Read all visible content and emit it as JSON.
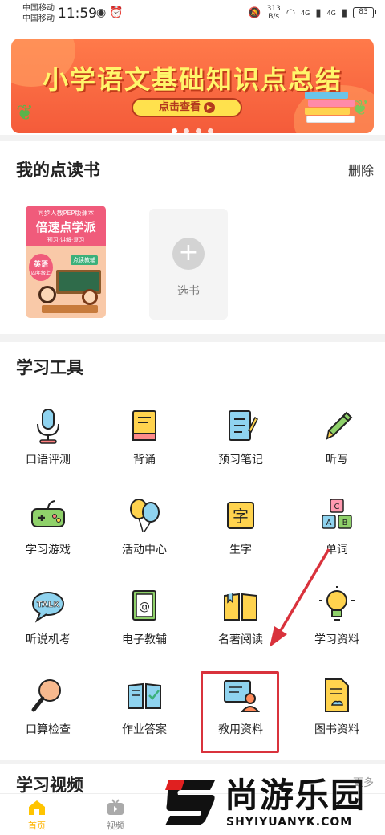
{
  "status": {
    "carrier1": "中国移动",
    "carrier2": "中国移动",
    "time": "11:59",
    "speed_value": "313",
    "speed_unit": "B/s",
    "net1": "4G",
    "net2": "4G",
    "battery": "83"
  },
  "banner": {
    "title": "小学语文基础知识点总结",
    "button": "点击查看",
    "slide_count": 4,
    "active_slide": 0
  },
  "my_books": {
    "title": "我的点读书",
    "delete_label": "删除",
    "book": {
      "series": "同步人教PEP版课本",
      "name": "倍速点学派",
      "tagline": "预习·讲解·复习",
      "subject": "英语",
      "grade": "四年级上",
      "tag": "点读教辅"
    },
    "add_label": "选书"
  },
  "tools": {
    "title": "学习工具",
    "items": [
      {
        "label": "口语评测",
        "icon": "microphone-icon"
      },
      {
        "label": "背诵",
        "icon": "book-icon"
      },
      {
        "label": "预习笔记",
        "icon": "notebook-icon"
      },
      {
        "label": "听写",
        "icon": "pencil-icon"
      },
      {
        "label": "学习游戏",
        "icon": "gamepad-icon"
      },
      {
        "label": "活动中心",
        "icon": "balloons-icon"
      },
      {
        "label": "生字",
        "icon": "character-card-icon"
      },
      {
        "label": "单词",
        "icon": "letter-blocks-icon"
      },
      {
        "label": "听说机考",
        "icon": "talk-bubble-icon"
      },
      {
        "label": "电子教辅",
        "icon": "ebook-icon"
      },
      {
        "label": "名著阅读",
        "icon": "open-book-icon"
      },
      {
        "label": "学习资料",
        "icon": "lightbulb-icon"
      },
      {
        "label": "口算检查",
        "icon": "magnifier-icon"
      },
      {
        "label": "作业答案",
        "icon": "answer-book-icon"
      },
      {
        "label": "教用资料",
        "icon": "teacher-board-icon"
      },
      {
        "label": "图书资料",
        "icon": "document-icon"
      }
    ]
  },
  "videos": {
    "title": "学习视频",
    "more": "更多"
  },
  "nav": {
    "home": "首页",
    "video": "视频"
  },
  "watermark": {
    "cn": "尚游乐园",
    "en": "SHYIYUANYK.COM"
  },
  "colors": {
    "accent": "#ffc400",
    "banner": "#f45b3a",
    "highlight": "#d9323c"
  }
}
